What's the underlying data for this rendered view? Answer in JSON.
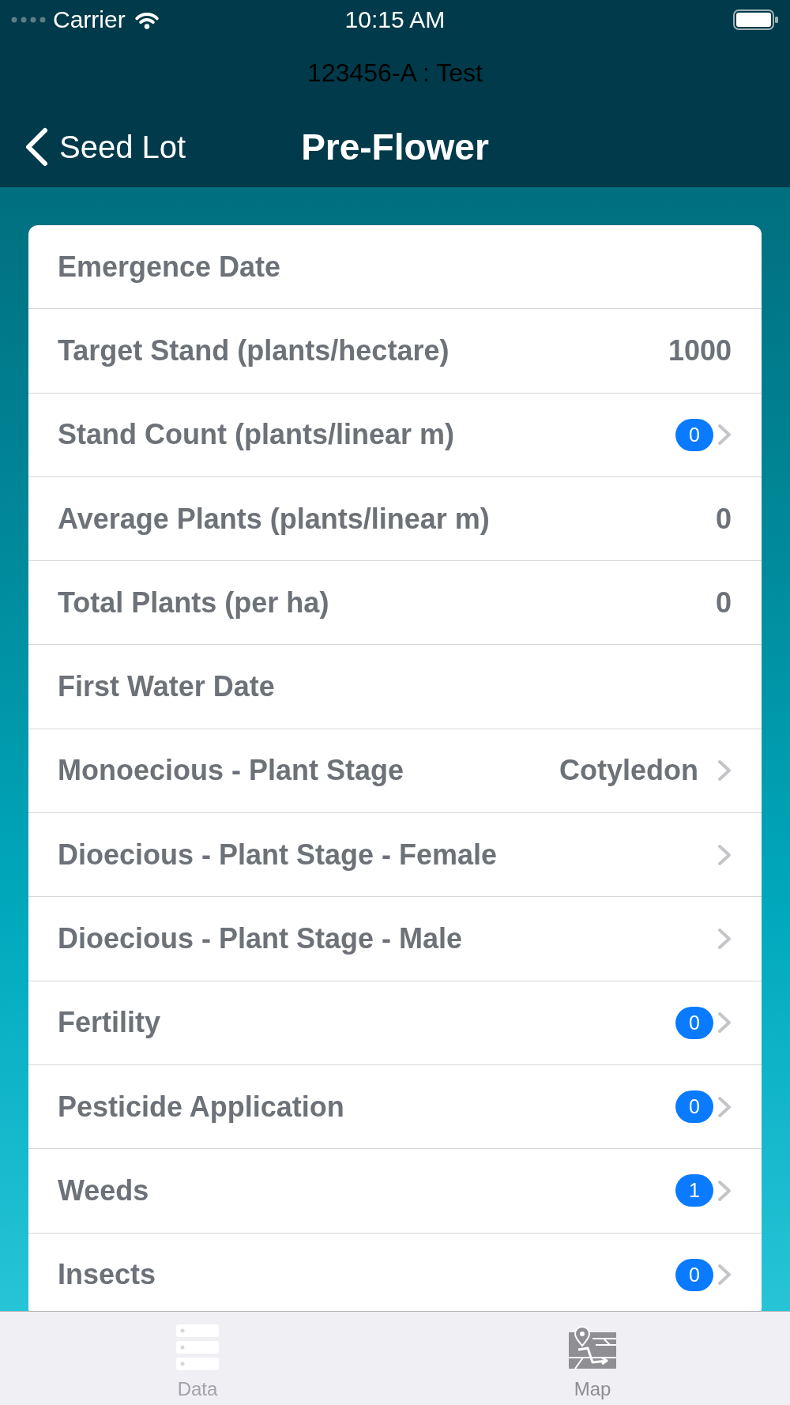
{
  "status_bar": {
    "carrier": "Carrier",
    "time": "10:15 AM"
  },
  "nav_bar": {
    "subtitle": "123456-A : Test",
    "back_label": "Seed Lot",
    "title": "Pre-Flower"
  },
  "rows": [
    {
      "label": "Emergence Date",
      "disclosure": false
    },
    {
      "label": "Target Stand (plants/hectare)",
      "value": "1000",
      "disclosure": false
    },
    {
      "label": "Stand Count (plants/linear m)",
      "badge": "0",
      "disclosure": true
    },
    {
      "label": "Average Plants (plants/linear m)",
      "value": "0",
      "disclosure": false
    },
    {
      "label": "Total Plants (per ha)",
      "value": "0",
      "disclosure": false
    },
    {
      "label": "First Water Date",
      "disclosure": false
    },
    {
      "label": "Monoecious - Plant Stage",
      "value": "Cotyledon",
      "disclosure": true
    },
    {
      "label": "Dioecious - Plant Stage - Female",
      "disclosure": true
    },
    {
      "label": "Dioecious - Plant Stage - Male",
      "disclosure": true
    },
    {
      "label": "Fertility",
      "badge": "0",
      "disclosure": true
    },
    {
      "label": "Pesticide Application",
      "badge": "0",
      "disclosure": true
    },
    {
      "label": "Weeds",
      "badge": "1",
      "disclosure": true
    },
    {
      "label": "Insects",
      "badge": "0",
      "disclosure": true
    }
  ],
  "tab_bar": {
    "tabs": [
      {
        "label": "Data",
        "kind": "data",
        "selected": true
      },
      {
        "label": "Map",
        "kind": "map",
        "selected": false
      }
    ]
  }
}
